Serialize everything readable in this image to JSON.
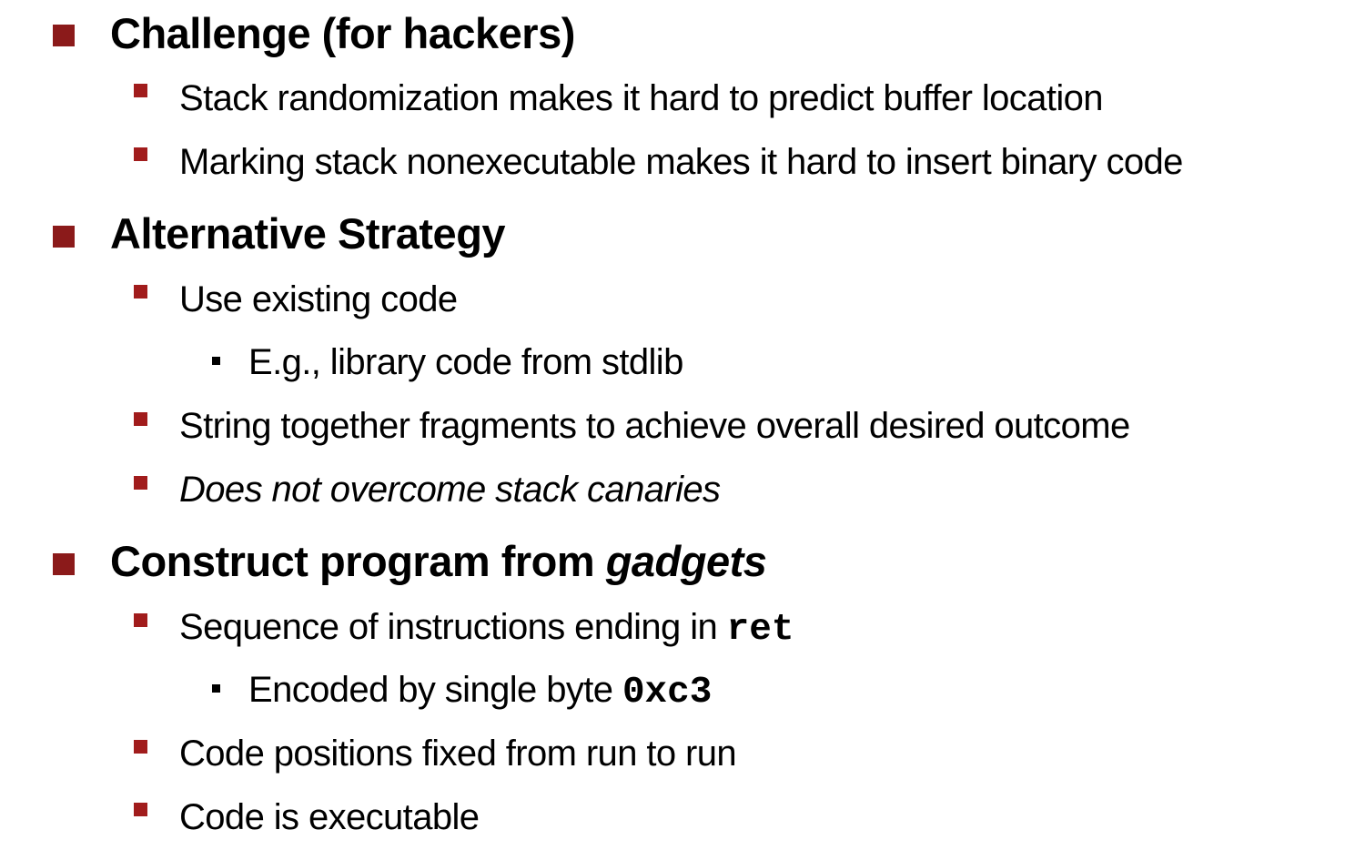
{
  "slide": {
    "sections": [
      {
        "heading": "Challenge (for hackers)",
        "items": [
          {
            "text": "Stack randomization makes it hard to predict buffer location"
          },
          {
            "text": "Marking stack nonexecutable makes it hard to insert binary code"
          }
        ]
      },
      {
        "heading": "Alternative Strategy",
        "items": [
          {
            "text": "Use existing code",
            "subitems": [
              {
                "text": "E.g., library code from stdlib"
              }
            ]
          },
          {
            "text": "String together fragments to achieve overall desired outcome"
          },
          {
            "text": "Does not overcome stack canaries"
          }
        ]
      },
      {
        "heading_prefix": "Construct program from ",
        "heading_emphasis": "gadgets",
        "items": [
          {
            "text_prefix": "Sequence of instructions ending in ",
            "code": "ret",
            "subitems": [
              {
                "text_prefix": "Encoded by single byte ",
                "code": "0xc3"
              }
            ]
          },
          {
            "text": "Code positions fixed from run to run"
          },
          {
            "text": "Code is executable"
          }
        ]
      }
    ],
    "colors": {
      "level1_bullet": "#8b1a1a",
      "level2_bullet": "#a11c1c",
      "level3_bullet": "#000000",
      "text": "#000000",
      "background": "#ffffff"
    }
  }
}
